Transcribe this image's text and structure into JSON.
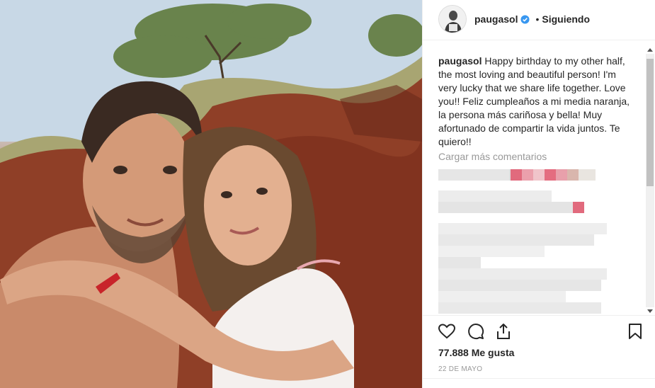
{
  "post": {
    "username": "paugasol",
    "separator": "•",
    "follow_label": "Siguiendo",
    "caption_text": "Happy birthday to my other half, the most loving and beautiful person! I'm very lucky that we share life together. Love you!! Feliz cumpleaños a mi media naranja, la persona más cariñosa y bella! Muy afortunado de compartir la vida juntos. Te quiero!!",
    "load_more": "Cargar más comentarios",
    "likes": "77.888 Me gusta",
    "date": "22 DE MAYO"
  },
  "icons": {
    "verified": "verified-badge-icon",
    "like": "heart-icon",
    "comment": "comment-bubble-icon",
    "share": "share-icon",
    "save": "bookmark-icon"
  },
  "colors": {
    "verified_blue": "#3897f0",
    "text": "#262626",
    "muted": "#999999",
    "pixel_pink": "#e16a7d"
  }
}
